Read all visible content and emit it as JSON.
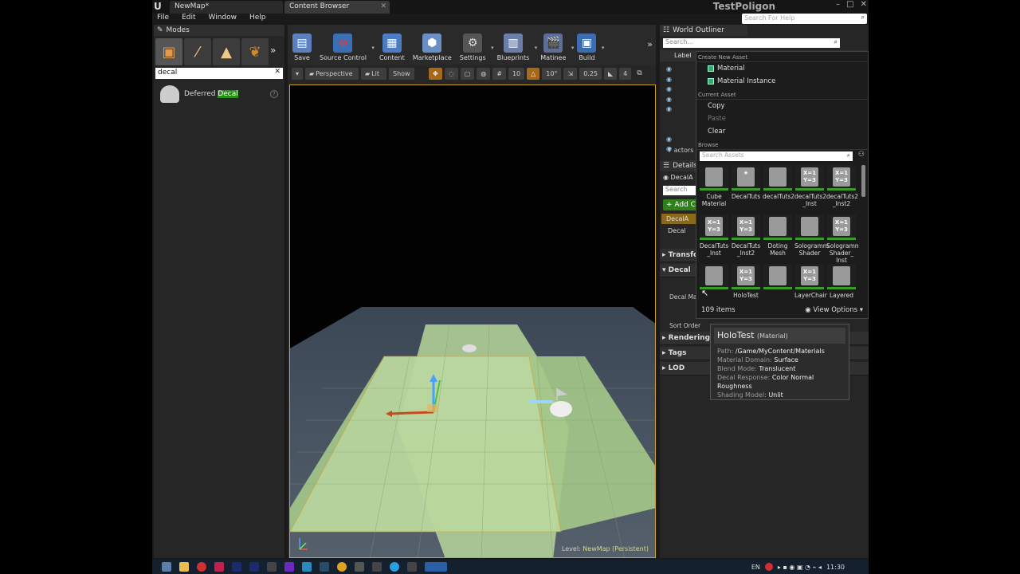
{
  "title_bar": {
    "tabs": [
      "NewMap*",
      "Content Browser"
    ],
    "project_name": "TestPoligon",
    "help_search_placeholder": "Search For Help"
  },
  "menu": [
    "File",
    "Edit",
    "Window",
    "Help"
  ],
  "modes": {
    "header": "Modes",
    "search_value": "decal",
    "result_prefix": "Deferred ",
    "result_match": "Decal"
  },
  "toolbar": {
    "buttons": [
      "Save",
      "Source Control",
      "Content",
      "Marketplace",
      "Settings",
      "Blueprints",
      "Matinee",
      "Build"
    ]
  },
  "viewport": {
    "mode_buttons": [
      "Perspective",
      "Lit",
      "Show"
    ],
    "grid_snap": "10",
    "rotation_snap": "10°",
    "scale_snap": "0.25",
    "camera_speed": "4",
    "level_label": "Level:",
    "level_name": "NewMap (Persistent)"
  },
  "world_outliner": {
    "header": "World Outliner",
    "search_placeholder": "Search...",
    "column_label": "Label",
    "actor_count": "7 actors"
  },
  "details": {
    "header": "Details",
    "actor_name": "DecalA",
    "search_placeholder": "Search",
    "add_component": "+ Add C",
    "component_root": "DecalA",
    "component_child": "Decal",
    "sections": [
      "Transform",
      "Decal",
      "Rendering",
      "Tags",
      "LOD"
    ],
    "decal_material_label": "Decal Materia",
    "sort_order_label": "Sort Order"
  },
  "asset_picker": {
    "create_header": "Create New Asset",
    "create_items": [
      "Material",
      "Material Instance"
    ],
    "current_header": "Current Asset",
    "current_items": [
      "Copy",
      "Paste",
      "Clear"
    ],
    "browse_header": "Browse",
    "search_placeholder": "Search Assets",
    "assets": [
      {
        "name": "Cube Material",
        "badge": ""
      },
      {
        "name": "DecalTuts",
        "badge": "★"
      },
      {
        "name": "decalTuts2",
        "badge": ""
      },
      {
        "name": "decalTuts2 _Inst",
        "badge": "X=1 Y=3"
      },
      {
        "name": "decalTuts2 _Inst2",
        "badge": "X=1 Y=3"
      },
      {
        "name": "DecalTuts _Inst",
        "badge": "X=1 Y=3"
      },
      {
        "name": "DecalTuts _Inst2",
        "badge": "X=1 Y=3"
      },
      {
        "name": "Doting Mesh",
        "badge": ""
      },
      {
        "name": "Sologramm Shader",
        "badge": ""
      },
      {
        "name": "Sologramm Shader_ Inst",
        "badge": "X=1 Y=3"
      },
      {
        "name": "",
        "badge": ""
      },
      {
        "name": "HoloTest",
        "badge": "X=1 Y=3"
      },
      {
        "name": "",
        "badge": ""
      },
      {
        "name": "LayerChair",
        "badge": "X=1 Y=3"
      },
      {
        "name": "Layered",
        "badge": ""
      }
    ],
    "item_count": "109 items",
    "view_options": "View Options"
  },
  "tooltip": {
    "name": "HoloTest",
    "type": "(Material)",
    "rows": [
      {
        "key": "Path:",
        "value": "/Game/MyContent/Materials"
      },
      {
        "key": "Material Domain:",
        "value": "Surface"
      },
      {
        "key": "Blend Mode:",
        "value": "Translucent"
      },
      {
        "key": "Decal Response:",
        "value": "Color Normal Roughness"
      },
      {
        "key": "Shading Model:",
        "value": "Unlit"
      }
    ]
  },
  "taskbar": {
    "language": "EN",
    "time": "11:30"
  },
  "colors": {
    "accent_green": "#2f7f1a",
    "selection_orange": "#c9a227"
  }
}
